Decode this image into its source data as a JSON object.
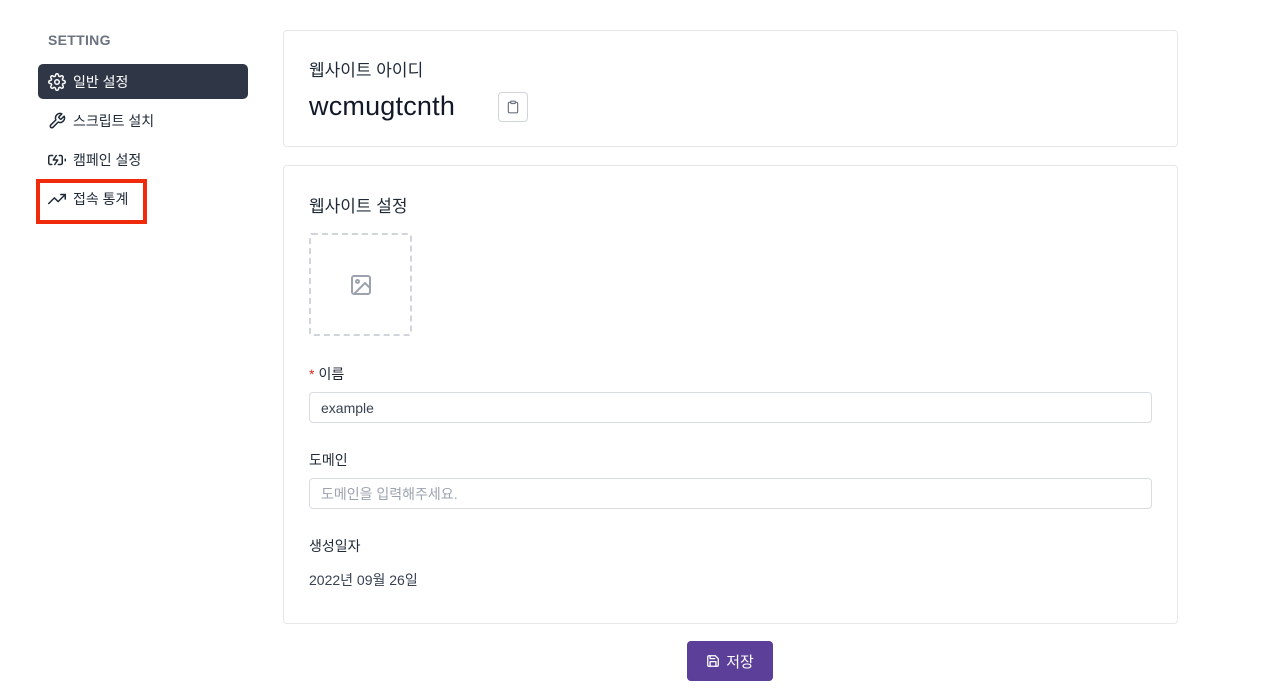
{
  "sidebar": {
    "heading": "SETTING",
    "items": [
      {
        "label": "일반 설정",
        "icon": "gear-icon",
        "active": true
      },
      {
        "label": "스크립트 설치",
        "icon": "wrench-icon",
        "active": false
      },
      {
        "label": "캠페인 설정",
        "icon": "battery-charging-icon",
        "active": false
      },
      {
        "label": "접속 통계",
        "icon": "trending-up-icon",
        "active": false,
        "highlighted": true
      }
    ]
  },
  "id_card": {
    "label": "웹사이트 아이디",
    "site_id": "wcmugtcnth",
    "copy_icon": "clipboard-icon"
  },
  "settings_card": {
    "title": "웹사이트 설정",
    "upload_icon": "image-icon",
    "name_required_mark": "*",
    "name_label": "이름",
    "name_value": "example",
    "domain_label": "도메인",
    "domain_placeholder": "도메인을 입력해주세요.",
    "created_label": "생성일자",
    "created_value": "2022년 09월 26일"
  },
  "save_button": {
    "label": "저장",
    "icon": "save-icon",
    "color": "#5b3f99"
  },
  "colors": {
    "active_nav_bg": "#2f3747",
    "highlight_border": "#ef2b0c",
    "required": "#dc2626"
  }
}
